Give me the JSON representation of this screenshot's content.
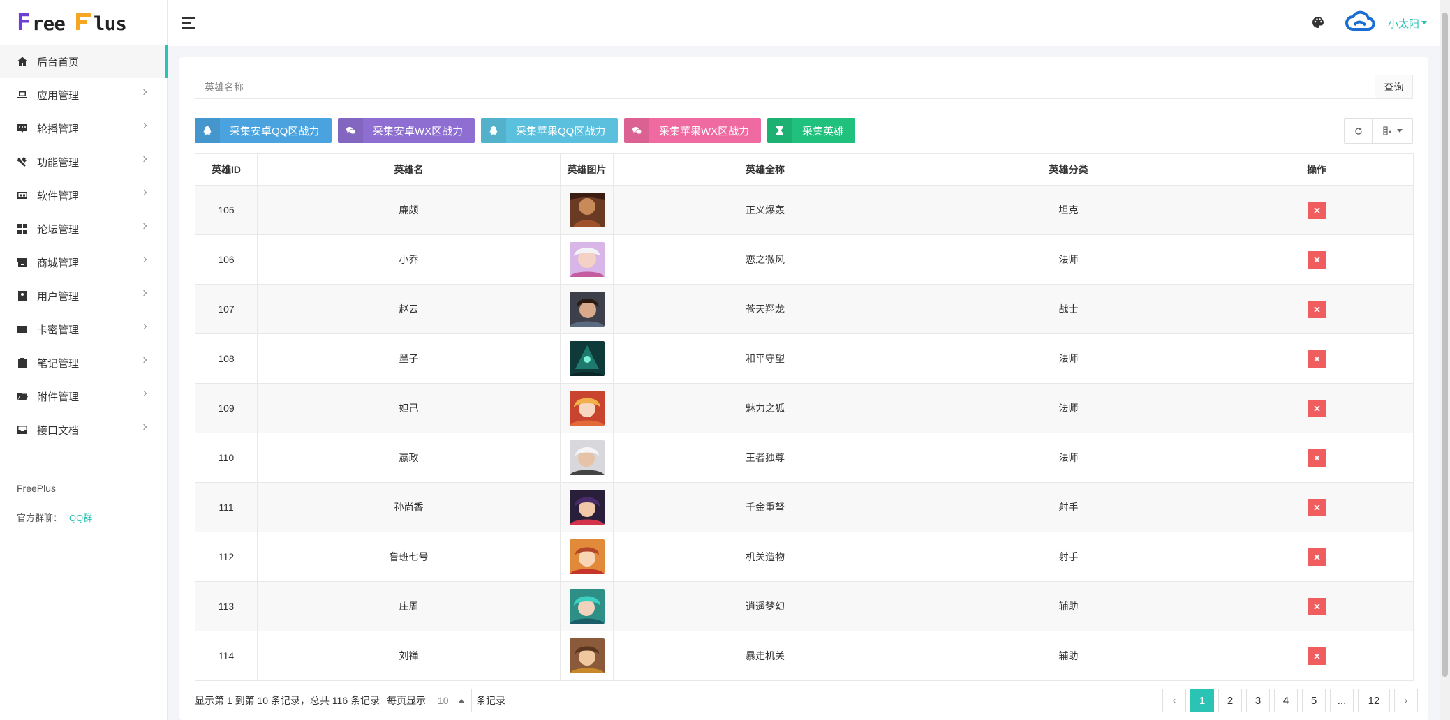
{
  "brand": {
    "logo_text": "FreePlus",
    "footer_name": "FreePlus",
    "group_label": "官方群聊：",
    "group_link": "QQ群"
  },
  "sidebar": {
    "items": [
      {
        "label": "后台首页",
        "icon": "home-icon",
        "active": true
      },
      {
        "label": "应用管理",
        "icon": "laptop-icon"
      },
      {
        "label": "轮播管理",
        "icon": "slideshow-icon"
      },
      {
        "label": "功能管理",
        "icon": "tools-icon"
      },
      {
        "label": "软件管理",
        "icon": "software-icon"
      },
      {
        "label": "论坛管理",
        "icon": "grid-icon"
      },
      {
        "label": "商城管理",
        "icon": "store-icon"
      },
      {
        "label": "用户管理",
        "icon": "user-badge-icon"
      },
      {
        "label": "卡密管理",
        "icon": "card-icon"
      },
      {
        "label": "笔记管理",
        "icon": "clipboard-icon"
      },
      {
        "label": "附件管理",
        "icon": "folder-open-icon"
      },
      {
        "label": "接口文档",
        "icon": "inbox-icon"
      }
    ]
  },
  "header": {
    "user_name": "小太阳"
  },
  "search": {
    "placeholder": "英雄名称",
    "button": "查询"
  },
  "toolbar": {
    "buttons": [
      {
        "label": "采集安卓QQ区战力",
        "icon": "qq-icon",
        "color": "#4aa3df"
      },
      {
        "label": "采集安卓WX区战力",
        "icon": "wechat-icon",
        "color": "#8e6fd1"
      },
      {
        "label": "采集苹果QQ区战力",
        "icon": "qq-icon",
        "color": "#5bc0de"
      },
      {
        "label": "采集苹果WX区战力",
        "icon": "wechat-icon",
        "color": "#ef6aa0"
      },
      {
        "label": "采集英雄",
        "icon": "hourglass-icon",
        "color": "#1fc17c"
      }
    ]
  },
  "table": {
    "headers": [
      "英雄ID",
      "英雄名",
      "英雄图片",
      "英雄全称",
      "英雄分类",
      "操作"
    ],
    "rows": [
      {
        "id": "105",
        "name": "廉颇",
        "full_name": "正义爆轰",
        "category": "坦克"
      },
      {
        "id": "106",
        "name": "小乔",
        "full_name": "恋之微风",
        "category": "法师"
      },
      {
        "id": "107",
        "name": "赵云",
        "full_name": "苍天翔龙",
        "category": "战士"
      },
      {
        "id": "108",
        "name": "墨子",
        "full_name": "和平守望",
        "category": "法师"
      },
      {
        "id": "109",
        "name": "妲己",
        "full_name": "魅力之狐",
        "category": "法师"
      },
      {
        "id": "110",
        "name": "嬴政",
        "full_name": "王者独尊",
        "category": "法师"
      },
      {
        "id": "111",
        "name": "孙尚香",
        "full_name": "千金重弩",
        "category": "射手"
      },
      {
        "id": "112",
        "name": "鲁班七号",
        "full_name": "机关造物",
        "category": "射手"
      },
      {
        "id": "113",
        "name": "庄周",
        "full_name": "逍遥梦幻",
        "category": "辅助"
      },
      {
        "id": "114",
        "name": "刘禅",
        "full_name": "暴走机关",
        "category": "辅助"
      }
    ]
  },
  "pagination": {
    "info": "显示第 1 到第 10 条记录，总共 116 条记录",
    "per_page_label": "每页显示",
    "per_page_value": "10",
    "per_page_suffix": "条记录",
    "prev": "‹",
    "next": "›",
    "pages": [
      "1",
      "2",
      "3",
      "4",
      "5",
      "...",
      "12"
    ],
    "current": "1"
  },
  "colors": {
    "accent": "#2bc3b4",
    "danger": "#f05d5e"
  }
}
